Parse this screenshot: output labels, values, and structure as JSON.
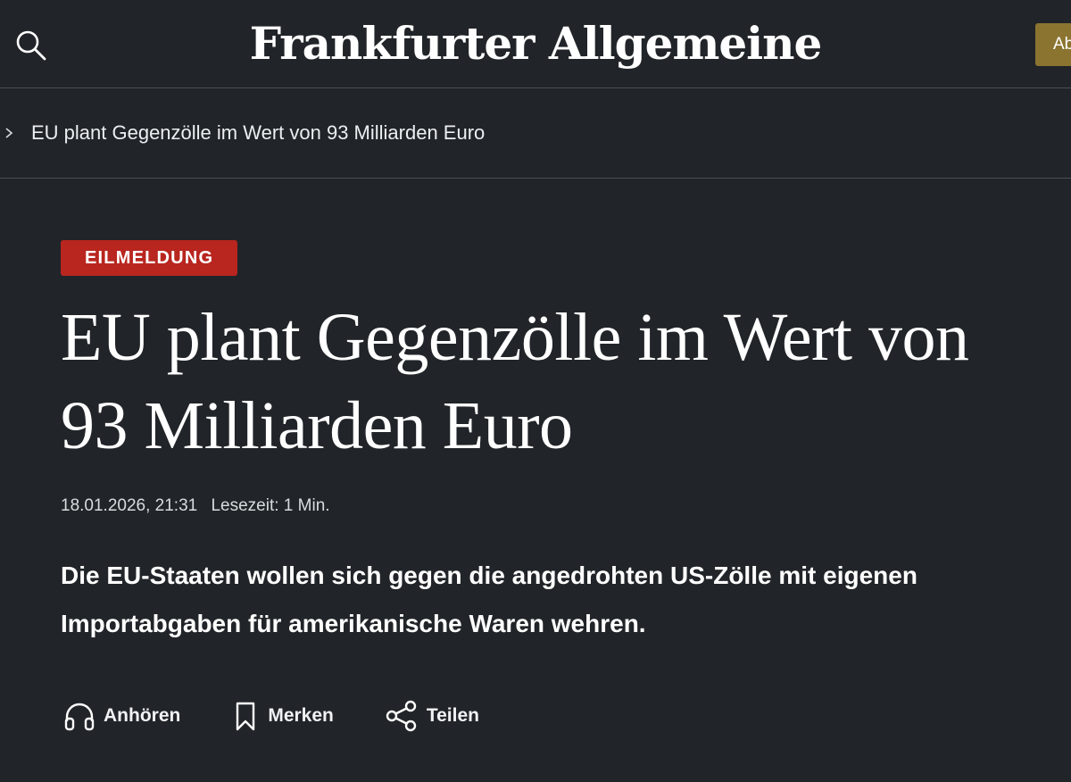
{
  "header": {
    "search_icon": "search-icon",
    "logo_text": "Frankfurter Allgemeine",
    "abo_label": "Ab",
    "accent_color": "#8a7430"
  },
  "breadcrumb": {
    "chevron_icon": "chevron-right-icon",
    "label": "EU plant Gegenzölle im Wert von 93 Milliarden Euro"
  },
  "article": {
    "badge": "EILMELDUNG",
    "badge_color": "#b8261f",
    "headline": "EU plant Gegenzölle im Wert von 93 Milliarden Euro",
    "date": "18.01.2026, 21:31",
    "reading_time": "Lesezeit: 1 Min.",
    "teaser": "Die EU-Staaten wollen sich gegen die angedrohten US-Zölle mit eigenen Importabgaben für amerikanische Waren wehren."
  },
  "actions": {
    "listen_label": "Anhören",
    "listen_icon": "headphones-icon",
    "save_label": "Merken",
    "save_icon": "bookmark-icon",
    "share_label": "Teilen",
    "share_icon": "share-icon"
  }
}
